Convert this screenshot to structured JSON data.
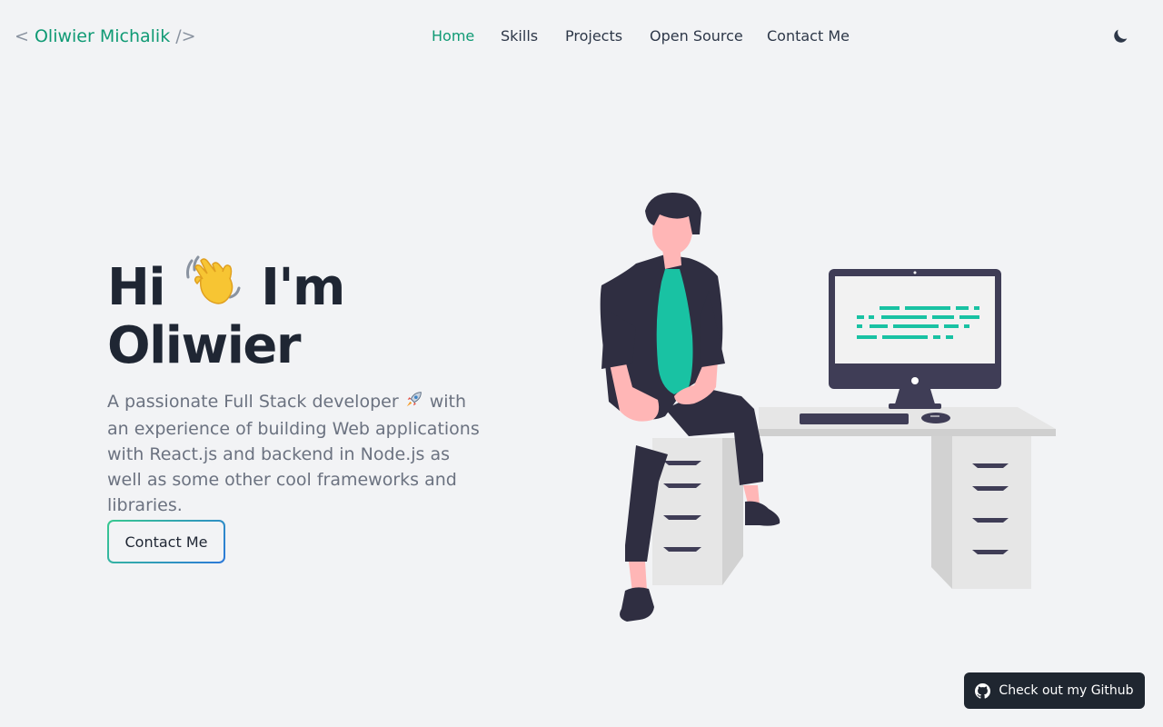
{
  "header": {
    "logo": {
      "open": "<",
      "name": "Oliwier Michalik",
      "close": "/>"
    },
    "nav": [
      {
        "label": "Home",
        "active": true
      },
      {
        "label": "Skills",
        "active": false
      },
      {
        "label": "Projects",
        "active": false
      },
      {
        "label": "Open Source",
        "active": false
      },
      {
        "label": "Contact Me",
        "active": false
      }
    ],
    "theme_toggle_icon": "moon-icon"
  },
  "hero": {
    "greeting": "Hi",
    "wave_icon": "waving-hand-icon",
    "im": "I'm",
    "name": "Oliwier",
    "desc_before_icon": "A passionate Full Stack developer",
    "rocket_icon": "rocket-icon",
    "desc_after_icon": "with an experience of building Web applications with React.js and backend in Node.js as well as some other cool frameworks and libraries.",
    "cta_label": "Contact Me",
    "illustration_icon": "developer-at-desk-illustration"
  },
  "github_button": {
    "label": "Check out my Github",
    "icon": "github-icon"
  },
  "colors": {
    "background": "#f2f3f5",
    "accent": "#0f9a74",
    "text_dark": "#1f2633",
    "text_muted": "#6b7280",
    "screen_code": "#19c2a3",
    "figure_dark": "#2f2e41",
    "shirt": "#19c2a3",
    "skin": "#ffb6b6",
    "desk": "#e6e6e6",
    "github_bg": "#1f2630",
    "gradient_start": "#38c98f",
    "gradient_end": "#2b78d9"
  }
}
